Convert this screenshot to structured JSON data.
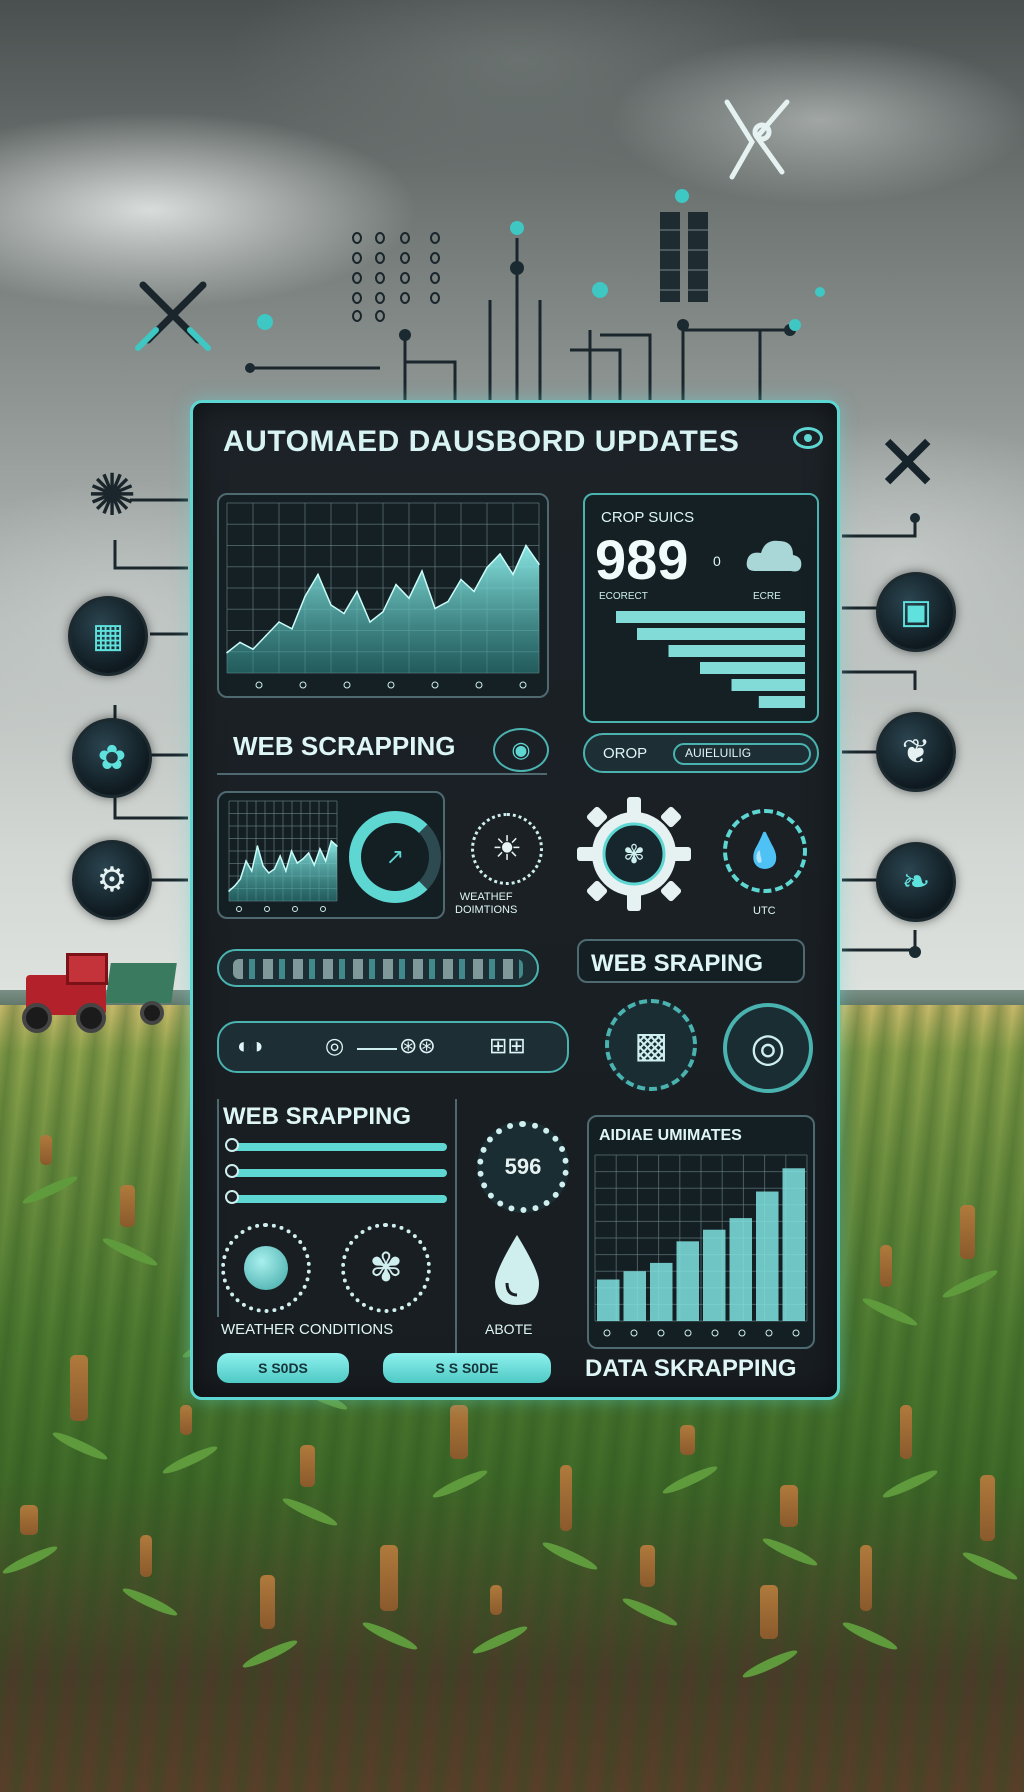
{
  "dashboard": {
    "title": "AUTOMAED DAUSBORD UPDATES",
    "crop_card": {
      "label": "CROP SUICS",
      "value": "989",
      "unit": "0",
      "sub_left": "ECORECT",
      "sub_right": "ECRE"
    },
    "section_web_scrapping": "WEB SCRAPPING",
    "crop_pill": {
      "left": "OROP",
      "right": "AUIELUILIG"
    },
    "weather_widget_label": "WEATHEF\nDOIMTIONS",
    "drop_label": "UTC",
    "web_sraping_badge": "WEB SRAPING",
    "left_block_title": "WEB SRAPPING",
    "stat_badge_value": "596",
    "weather_conditions": "WEATHER CONDITIONS",
    "abote_label": "ABOTE",
    "bar_card_title": "AIDIAE UMIMATES",
    "btn_left": "S S0DS",
    "btn_right": "S S S0DE",
    "footer_label": "DATA SKRAPPING"
  },
  "chart_data": [
    {
      "type": "area",
      "title": "",
      "x": [
        0,
        1,
        2,
        3,
        4,
        5,
        6,
        7,
        8,
        9,
        10,
        11,
        12,
        13,
        14,
        15,
        16,
        17,
        18,
        19,
        20,
        21,
        22,
        23,
        24
      ],
      "values": [
        12,
        18,
        14,
        22,
        30,
        26,
        45,
        58,
        40,
        35,
        48,
        30,
        36,
        52,
        44,
        60,
        38,
        42,
        55,
        48,
        62,
        70,
        58,
        75,
        64
      ],
      "ylim": [
        0,
        100
      ],
      "grid": true
    },
    {
      "type": "area",
      "title": "",
      "x": [
        0,
        1,
        2,
        3,
        4,
        5,
        6,
        7,
        8,
        9,
        10,
        11,
        12,
        13,
        14,
        15,
        16,
        17,
        18,
        19
      ],
      "values": [
        10,
        15,
        22,
        40,
        30,
        55,
        35,
        28,
        32,
        45,
        30,
        50,
        38,
        42,
        48,
        36,
        52,
        40,
        60,
        55
      ],
      "ylim": [
        0,
        100
      ],
      "grid": true
    },
    {
      "type": "bar",
      "title": "",
      "values": [
        25,
        30,
        35,
        48,
        55,
        62,
        78,
        92
      ],
      "ylim": [
        0,
        100
      ],
      "grid": true
    },
    {
      "type": "bar",
      "title": "",
      "values": [
        90,
        80,
        65,
        50,
        35,
        22
      ],
      "ylim": [
        0,
        100
      ]
    }
  ],
  "colors": {
    "accent": "#5ed6d2",
    "panel": "#1a2024",
    "text": "#dff6f6"
  },
  "icons": {
    "top_cross": "pliers-icon",
    "top_right": "scissors-icon",
    "right_x": "close-icon",
    "left_nodes": [
      "flower-icon",
      "grid-icon",
      "tractor-icon",
      "gear-icon"
    ],
    "right_nodes": [
      "chip-icon",
      "leaf-icon",
      "plant-icon"
    ]
  }
}
